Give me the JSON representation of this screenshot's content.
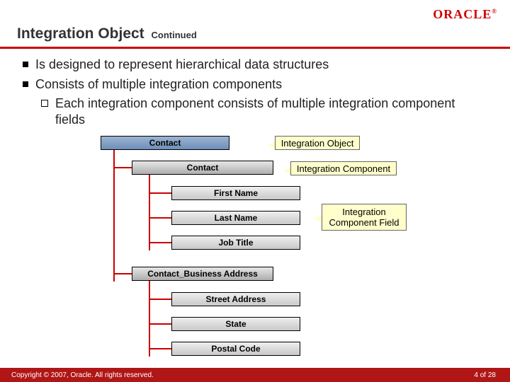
{
  "brand": {
    "name": "ORACLE"
  },
  "title": {
    "main": "Integration Object",
    "continued": "Continued"
  },
  "bullets": {
    "b1a": "Is designed to represent hierarchical data structures",
    "b1b": "Consists of multiple integration components",
    "b2a": "Each integration component consists of multiple integration component fields"
  },
  "diagram": {
    "root": "Contact",
    "comp1": {
      "label": "Contact",
      "fields": [
        "First Name",
        "Last Name",
        "Job Title"
      ]
    },
    "comp2": {
      "label": "Contact_Business Address",
      "fields": [
        "Street Address",
        "State",
        "Postal Code"
      ]
    }
  },
  "callouts": {
    "io": "Integration Object",
    "ic": "Integration Component",
    "icf": "Integration\nComponent Field"
  },
  "footer": {
    "copyright": "Copyright © 2007, Oracle. All rights reserved.",
    "page": "4 of 28"
  }
}
